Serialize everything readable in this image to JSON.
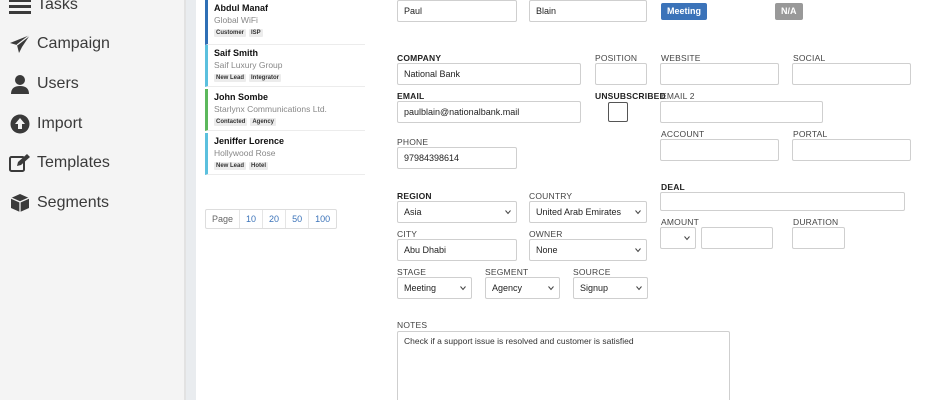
{
  "sidebar": {
    "items": [
      {
        "label": "Tasks",
        "icon": "tasks-icon"
      },
      {
        "label": "Campaign",
        "icon": "paper-plane-icon"
      },
      {
        "label": "Users",
        "icon": "user-icon"
      },
      {
        "label": "Import",
        "icon": "arrow-up-circle-icon"
      },
      {
        "label": "Templates",
        "icon": "edit-icon"
      },
      {
        "label": "Segments",
        "icon": "cube-icon"
      }
    ]
  },
  "leads": [
    {
      "name": "Abdul Manaf",
      "company": "Global WiFi",
      "tags": [
        "Customer",
        "ISP"
      ],
      "color": "#2f6fb5"
    },
    {
      "name": "Saif Smith",
      "company": "Saif Luxury Group",
      "tags": [
        "New Lead",
        "Integrator"
      ],
      "color": "#5bc0de"
    },
    {
      "name": "John Sombe",
      "company": "Starlynx Communications Ltd.",
      "tags": [
        "Contacted",
        "Agency"
      ],
      "color": "#5cb85c"
    },
    {
      "name": "Jeniffer Lorence",
      "company": "Hollywood Rose",
      "tags": [
        "New Lead",
        "Hotel"
      ],
      "color": "#5bc0de"
    }
  ],
  "pager": {
    "label": "Page",
    "sizes": [
      "10",
      "20",
      "50",
      "100"
    ]
  },
  "form": {
    "first_name": "Paul",
    "last_name": "Blain",
    "stage_badge": "Meeting",
    "na_badge": "N/A",
    "company_label": "COMPANY",
    "company": "National Bank",
    "position_label": "POSITION",
    "position": "",
    "website_label": "WEBSITE",
    "website": "",
    "social_label": "SOCIAL",
    "social": "",
    "email_label": "EMAIL",
    "email": "paulblain@nationalbank.mail",
    "unsubscribed_label": "UNSUBSCRIBED",
    "email2_label": "EMAIL 2",
    "email2": "",
    "account_label": "ACCOUNT",
    "account": "",
    "portal_label": "PORTAL",
    "portal": "",
    "phone_label": "PHONE",
    "phone": "97984398614",
    "deal_label": "DEAL",
    "deal": "",
    "region_label": "REGION",
    "region": "Asia",
    "country_label": "COUNTRY",
    "country": "United Arab Emirates",
    "amount_label": "AMOUNT",
    "amount_currency": "",
    "amount": "",
    "duration_label": "DURATION",
    "duration": "",
    "city_label": "CITY",
    "city": "Abu Dhabi",
    "owner_label": "OWNER",
    "owner": "None",
    "stage_label": "STAGE",
    "stage": "Meeting",
    "segment_label": "SEGMENT",
    "segment": "Agency",
    "source_label": "SOURCE",
    "source": "Signup",
    "notes_label": "NOTES",
    "notes": "Check if a support issue is resolved and customer is satisfied"
  },
  "colors": {
    "meeting_badge": "#3b73b9",
    "na_badge": "#999999"
  }
}
